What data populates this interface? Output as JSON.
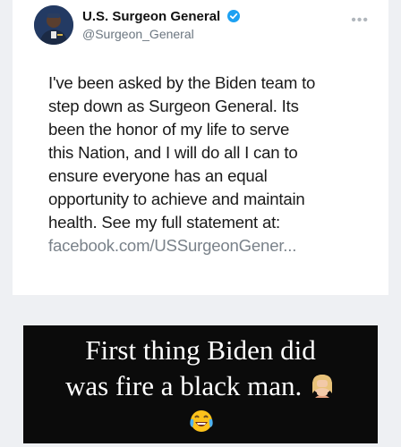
{
  "post": {
    "author_name": "U.S. Surgeon General",
    "handle": "@Surgeon_General",
    "more_icon": "more-options-icon",
    "body_lines": [
      "I've been asked by the Biden team to",
      "step down as Surgeon General.  Its",
      "been the honor of my life to serve",
      "this Nation, and I will do all I can to",
      "ensure everyone has an equal",
      "opportunity to achieve and maintain",
      "health. See my full statement at:"
    ],
    "link_text": "facebook.com/USSurgeonGener..."
  },
  "caption": {
    "line1": "First thing Biden did",
    "line2": "was fire a black man.",
    "emoji_facepalm": "person-facepalming-emoji",
    "emoji_laugh": "face-with-tears-of-joy-emoji"
  },
  "colors": {
    "verified": "#1da1f2",
    "link": "#7a828a",
    "caption_bg": "#0b0b0b",
    "background": "#eef0f3"
  }
}
